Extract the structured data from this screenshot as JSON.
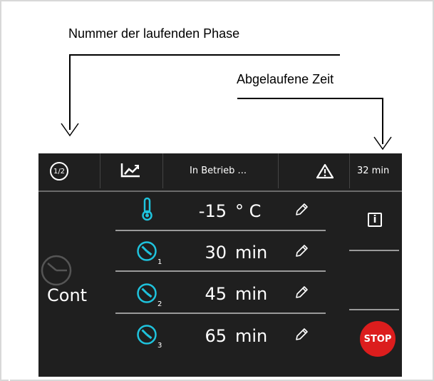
{
  "annotations": {
    "phase_label": "Nummer der laufenden Phase",
    "elapsed_label": "Abgelaufene Zeit"
  },
  "topbar": {
    "phase": "1/2",
    "status": "In Betrieb ...",
    "elapsed": "32 min",
    "chart_icon": "trend-chart-icon",
    "warning_icon": "warning-triangle-icon"
  },
  "params": {
    "temperature": {
      "value": "-15",
      "unit": "° C",
      "icon": "thermometer-icon"
    },
    "timers": [
      {
        "index": "1",
        "value": "30",
        "unit": "min",
        "icon": "timer-icon"
      },
      {
        "index": "2",
        "value": "45",
        "unit": "min",
        "icon": "timer-icon"
      },
      {
        "index": "3",
        "value": "65",
        "unit": "min",
        "icon": "timer-icon"
      }
    ]
  },
  "mode": {
    "label": "Cont",
    "icon": "clock-icon"
  },
  "buttons": {
    "info": "i",
    "stop": "STOP"
  },
  "colors": {
    "accent": "#1fc3dd",
    "stop": "#dc1d1d",
    "panel": "#1f1f1f"
  }
}
